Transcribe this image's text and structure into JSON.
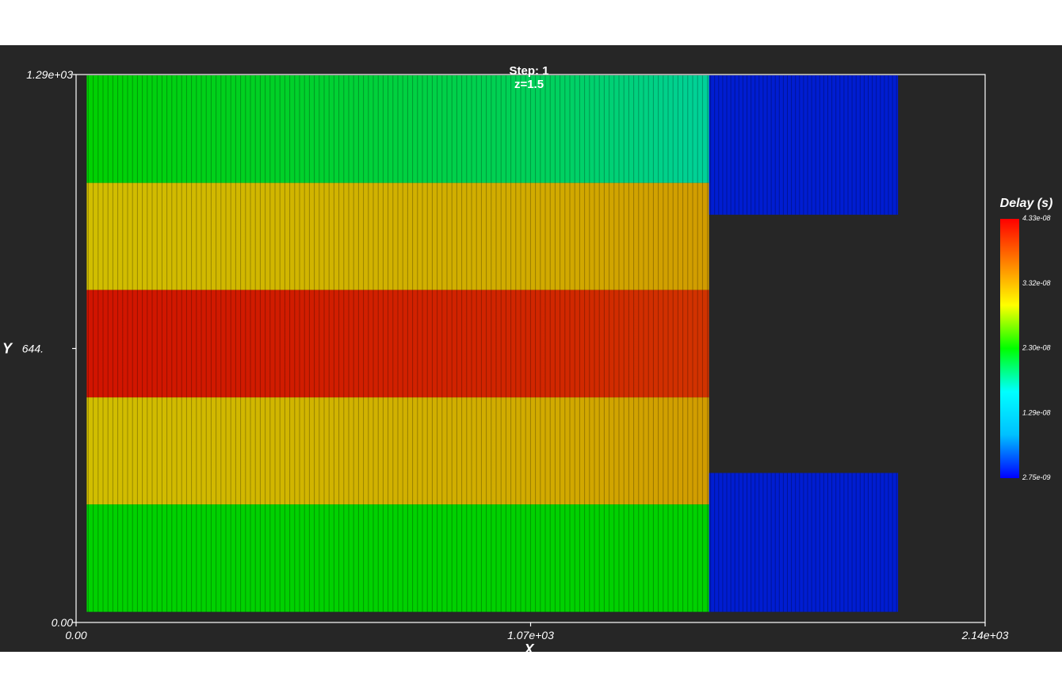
{
  "chart_data": {
    "type": "heatmap",
    "title_line1": "Step: 1",
    "title_line2": "z=1.5",
    "xlabel": "X",
    "ylabel": "Y",
    "xlim": [
      0,
      2140
    ],
    "ylim": [
      0,
      1290
    ],
    "x_ticks": [
      "0.00",
      "1.07e+03",
      "2.14e+03"
    ],
    "y_ticks": [
      "0.00",
      "644.",
      "1.29e+03"
    ],
    "colorbar": {
      "title": "Delay (s)",
      "min": 2.75e-09,
      "max": 4.33e-08,
      "tick_labels": [
        "4.33e-08",
        "3.32e-08",
        "2.30e-08",
        "1.29e-08",
        "2.75e-09"
      ],
      "colors": [
        "#0000ff",
        "#00c0ff",
        "#00ffff",
        "#00ff00",
        "#ffff00",
        "#ff8000",
        "#ff0000"
      ]
    },
    "regions": [
      {
        "name": "left-row-1",
        "x": [
          25,
          1490
        ],
        "y": [
          25,
          278
        ],
        "value_start": 2.3e-08,
        "value_end": 2.3e-08
      },
      {
        "name": "left-row-2",
        "x": [
          25,
          1490
        ],
        "y": [
          278,
          530
        ],
        "value_start": 3.1e-08,
        "value_end": 3.32e-08
      },
      {
        "name": "left-row-3",
        "x": [
          25,
          1490
        ],
        "y": [
          530,
          783
        ],
        "value_start": 4.2e-08,
        "value_end": 4e-08
      },
      {
        "name": "left-row-4",
        "x": [
          25,
          1490
        ],
        "y": [
          783,
          1035
        ],
        "value_start": 3.1e-08,
        "value_end": 3.32e-08
      },
      {
        "name": "left-row-5",
        "x": [
          25,
          1490
        ],
        "y": [
          1035,
          1288
        ],
        "value_start": 2.3e-08,
        "value_end": 1.8e-08
      },
      {
        "name": "right-bottom-block",
        "x": [
          1490,
          1935
        ],
        "y": [
          25,
          352
        ],
        "value_start": 4e-09,
        "value_end": 4e-09
      },
      {
        "name": "right-top-block",
        "x": [
          1490,
          1935
        ],
        "y": [
          960,
          1288
        ],
        "value_start": 4e-09,
        "value_end": 4e-09
      }
    ]
  }
}
